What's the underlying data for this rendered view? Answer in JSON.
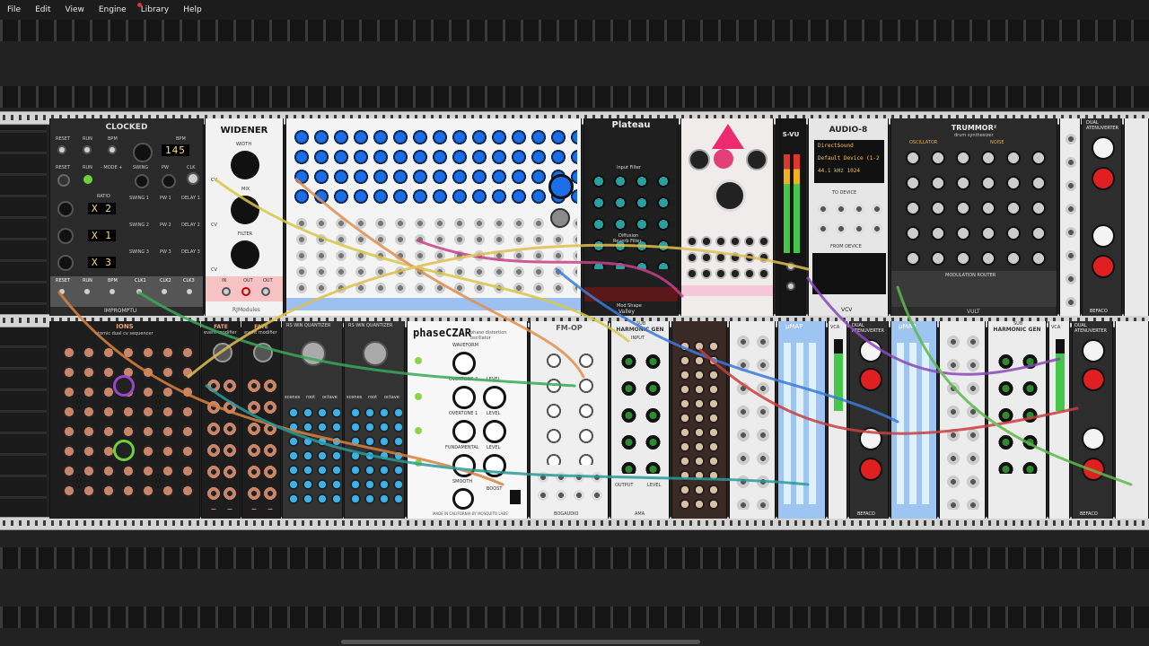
{
  "menu": [
    "File",
    "Edit",
    "View",
    "Engine",
    "Library",
    "Help"
  ],
  "colors": {
    "bg": "#222222",
    "rail": "#d4d4d4",
    "accent_blue": "#1b6ee8",
    "accent_red": "#e02020",
    "accent_green": "#6fd13a"
  },
  "modules_top": [
    {
      "title": "CLOCKED",
      "labels": [
        "RESET",
        "RUN",
        "BPM",
        "BPM",
        "RESET",
        "RUN",
        "- MODE +",
        "SWING",
        "PW",
        "CLK",
        "RATIO",
        "SWING 1",
        "PW 1",
        "DELAY 1",
        "SWING 2",
        "PW 2",
        "DELAY 2",
        "SWING 3",
        "PW 3",
        "DELAY 3",
        "RESET",
        "RUN",
        "BPM",
        "CLK1",
        "CLK2",
        "CLK3"
      ],
      "bpm": "145",
      "ratios": [
        "X 2",
        "X 1",
        "X 3"
      ],
      "brand": "IMPROMPTU"
    },
    {
      "title": "WIDENER",
      "labels": [
        "WIDTH",
        "MIX",
        "FILTER",
        "CV",
        "CV",
        "CV",
        "IN",
        "OUT",
        "OUT"
      ],
      "brand": "RJModules"
    },
    {
      "title": "Plateau",
      "labels": [
        "Input Filter",
        "Low",
        "High",
        "Tuned Mode",
        "Diffuse Input",
        "Size",
        "Decay",
        "Diffusion",
        "Reverb Filter",
        "Low",
        "High",
        "Hold",
        "Clear",
        "Mod Shape",
        "Mod Speed",
        "Mod Depth",
        "L In",
        "R In",
        "Dry",
        "Wet",
        "L Out",
        "R Out"
      ],
      "brand": "Valley"
    },
    {
      "title": "S-VU"
    },
    {
      "title": "AUDIO-8",
      "device": [
        "DirectSound",
        "Default Device (1-2",
        "44.1 kHz   1024"
      ],
      "to_device": "TO DEVICE",
      "from_device": "FROM DEVICE",
      "brand": "VCV"
    },
    {
      "title": "TRUMMOR²",
      "subtitle": "drum synthesizer",
      "sections": [
        "OSCILLATOR",
        "NOISE"
      ],
      "labels": [
        "TUNE",
        "BEND",
        "TIME",
        "TONE",
        "PITCH",
        "RESONA",
        "OSC 2",
        "WAVE",
        "SHAPER",
        "CUTOFF",
        "RES",
        "TYPE",
        "ATTACK",
        "HOLD",
        "DECAY",
        "ATTACK",
        "HOLD",
        "DECAY",
        "EXT",
        "PITCH",
        "ENV",
        "OUT",
        "OUT",
        "GATE",
        "EXT"
      ],
      "footer": "MODULATION ROUTER",
      "brand": "VULT"
    },
    {
      "title": "DUAL ATENUVERTER",
      "labels": [
        "ATENUVERTER",
        "OFFSET",
        "ATENUVERTER",
        "OFFSET",
        "IN",
        "OUT"
      ],
      "brand": "BEFACO"
    }
  ],
  "modules_bottom": [
    {
      "title": "IONS",
      "subtitle": "atomic dual cv sequencer"
    },
    {
      "title": "FATE",
      "subtitle": "event modifier"
    },
    {
      "title": "FATE",
      "subtitle": "event modifier"
    },
    {
      "title": "RS WIN QUANTIZER",
      "labels": [
        "scenes",
        "root",
        "octave"
      ]
    },
    {
      "title": "RS WIN QUANTIZER",
      "labels": [
        "scenes",
        "root",
        "octave"
      ]
    },
    {
      "title": "phaseCZAR",
      "subtitle": "phase distortion oscillator",
      "labels": [
        "WAVEFORM",
        "OVERTONE 2",
        "LEVEL",
        "OVERTONE 1",
        "LEVEL",
        "FUNDAMENTAL",
        "LEVEL",
        "SMOOTH",
        "BOOST",
        "V/OCT",
        "OUT",
        "LINK",
        "LINK",
        "LINK",
        "LINK",
        "CV",
        "CV"
      ],
      "footer": "MADE IN CALIFORNIA BY MOSQUITO LABS"
    },
    {
      "title": "FM-OP",
      "labels": [
        "DEPTH",
        "ATTACK",
        "DECAY",
        "SUS",
        "REL",
        "LEVEL",
        "FDBK",
        "V/OCT",
        "GATE",
        "OUT"
      ],
      "brand": "BOGAUDIO"
    },
    {
      "title": "HARMONIC GEN",
      "subtitle": "SUB",
      "labels": [
        "INPUT",
        "OUTPUT",
        "LEVEL"
      ],
      "brand": "AMA"
    },
    {
      "title": "μMAP"
    },
    {
      "title": "μMAP"
    },
    {
      "title": "VCA"
    },
    {
      "title": "DUAL ATENUVERTER",
      "labels": [
        "ATENUVERTER",
        "OFFSET"
      ],
      "brand": "BEFACO"
    }
  ]
}
